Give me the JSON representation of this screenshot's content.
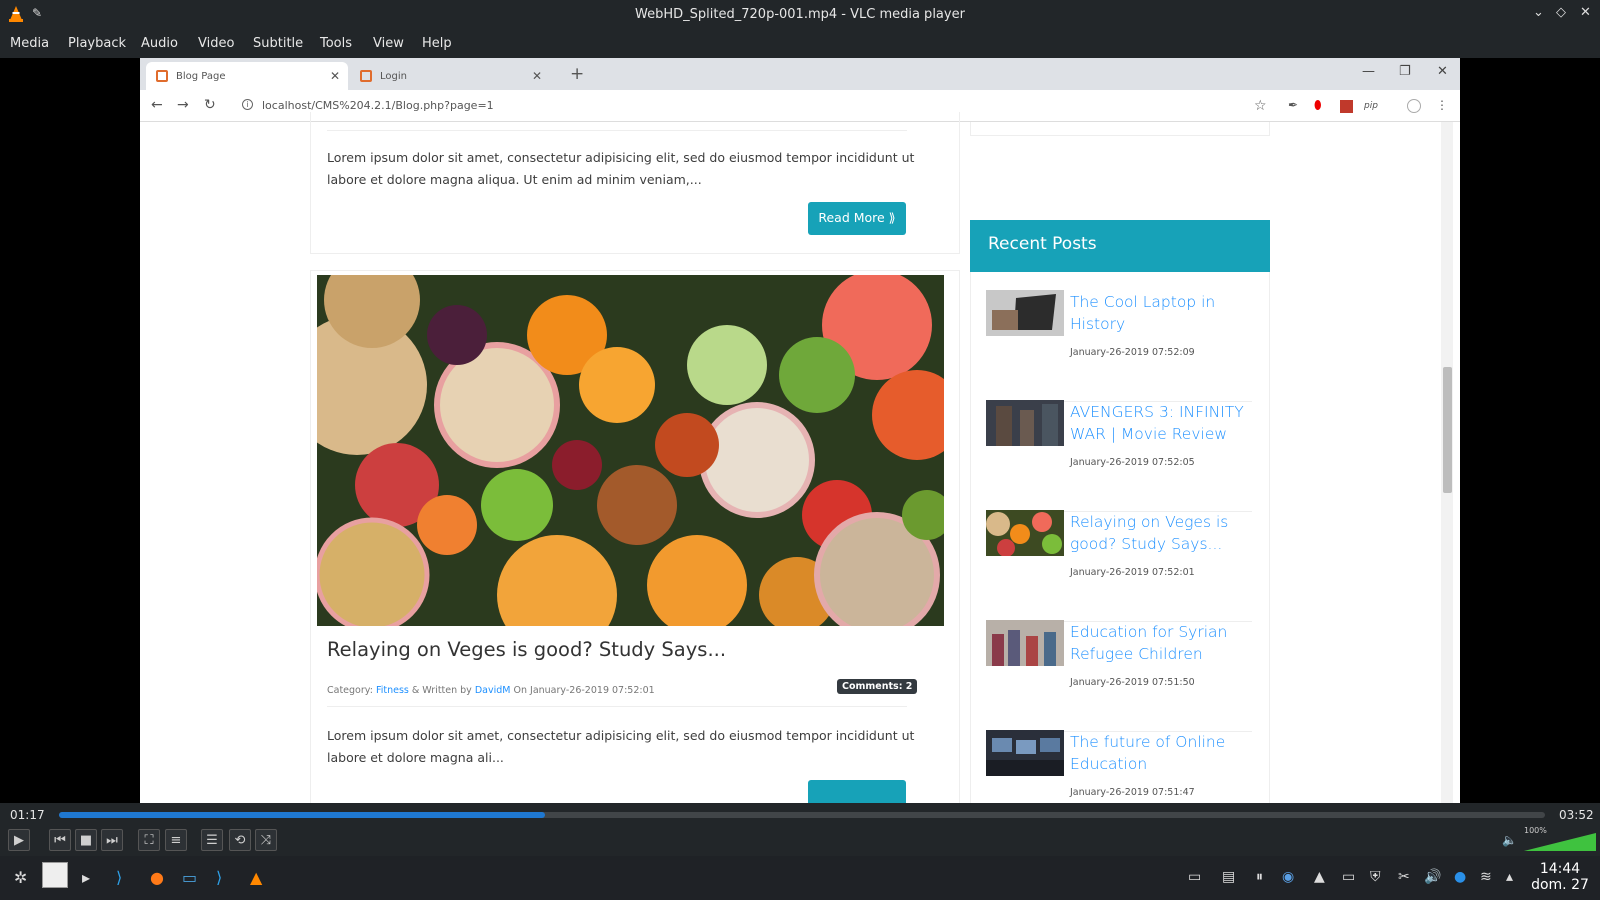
{
  "window": {
    "title": "WebHD_Splited_720p-001.mp4 - VLC media player"
  },
  "menu": [
    "Media",
    "Playback",
    "Audio",
    "Video",
    "Subtitle",
    "Tools",
    "View",
    "Help"
  ],
  "browser": {
    "tabs": [
      {
        "label": "Blog Page",
        "active": true
      },
      {
        "label": "Login",
        "active": false
      }
    ],
    "url": "localhost/CMS%204.2.1/Blog.php?page=1",
    "extensions": [
      "opera-icon",
      "pdf-icon",
      "pip-icon"
    ]
  },
  "page": {
    "post1": {
      "excerpt": "Lorem ipsum dolor sit amet, consectetur adipisicing elit, sed do eiusmod tempor incididunt ut labore et dolore magna aliqua. Ut enim ad minim veniam,...",
      "read_more": "Read More ⟫"
    },
    "post2": {
      "title": "Relaying on Veges is good? Study Says...",
      "meta_category_label": "Category:",
      "category": "Fitness",
      "meta_written_by": "& Written by",
      "author": "DavidM",
      "meta_on": "On January-26-2019 07:52:01",
      "comments": "Comments: 2",
      "excerpt": "Lorem ipsum dolor sit amet, consectetur adipisicing elit, sed do eiusmod tempor incididunt ut labore et dolore magna ali..."
    },
    "sidebar": {
      "heading": "Recent Posts",
      "posts": [
        {
          "title": "The Cool Laptop in History",
          "date": "January-26-2019 07:52:09"
        },
        {
          "title": "AVENGERS 3: INFINITY WAR | Movie Review",
          "date": "January-26-2019 07:52:05"
        },
        {
          "title": "Relaying on Veges is good? Study Says...",
          "date": "January-26-2019 07:52:01"
        },
        {
          "title": "Education for Syrian Refugee Children",
          "date": "January-26-2019 07:51:50"
        },
        {
          "title": "The future of Online Education",
          "date": "January-26-2019 07:51:47"
        }
      ]
    }
  },
  "player": {
    "elapsed": "01:17",
    "total": "03:52",
    "progress": 0.327,
    "volume_label": "100%",
    "volume": 1.0
  },
  "taskbar": {
    "time": "14:44",
    "date": "dom. 27"
  },
  "colors": {
    "accent": "#17a2b8",
    "vlc_bar": "#222629",
    "seek": "#1f78d1",
    "link": "#1e90ff"
  }
}
